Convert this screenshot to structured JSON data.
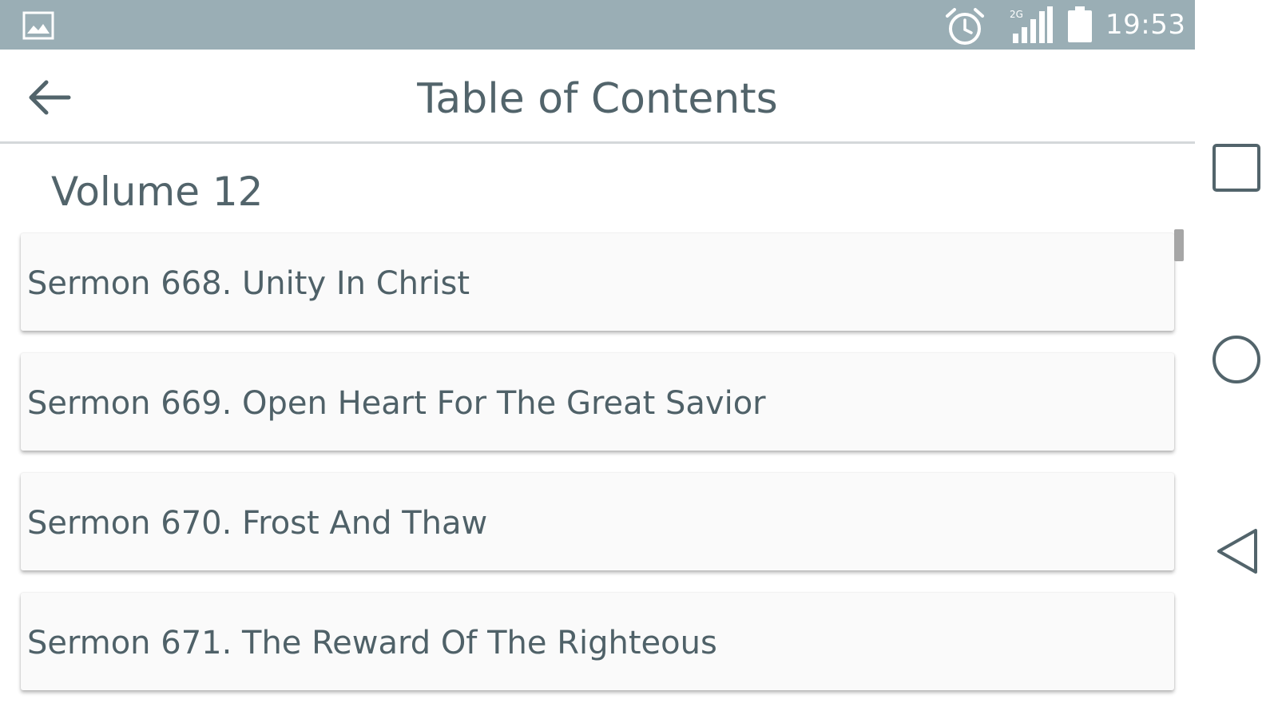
{
  "status_bar": {
    "time": "19:53",
    "network_type": "2G",
    "icons": [
      "gallery-icon",
      "alarm-icon",
      "signal-icon",
      "battery-icon"
    ]
  },
  "app_bar": {
    "title": "Table of Contents",
    "back_icon": "back-arrow-icon"
  },
  "content": {
    "volume_title": "Volume 12",
    "sermons": [
      {
        "label": "Sermon 668. Unity In Christ"
      },
      {
        "label": "Sermon 669. Open Heart For The Great Savior"
      },
      {
        "label": "Sermon 670. Frost And Thaw"
      },
      {
        "label": "Sermon 671. The Reward Of The Righteous"
      }
    ]
  },
  "nav_bar": {
    "icons": [
      "recents-square-icon",
      "home-circle-icon",
      "back-triangle-icon"
    ]
  },
  "colors": {
    "status_bar_bg": "#9aaeb5",
    "primary_text": "#52646b",
    "card_bg": "#fafafa",
    "divider": "#d4d8da"
  }
}
